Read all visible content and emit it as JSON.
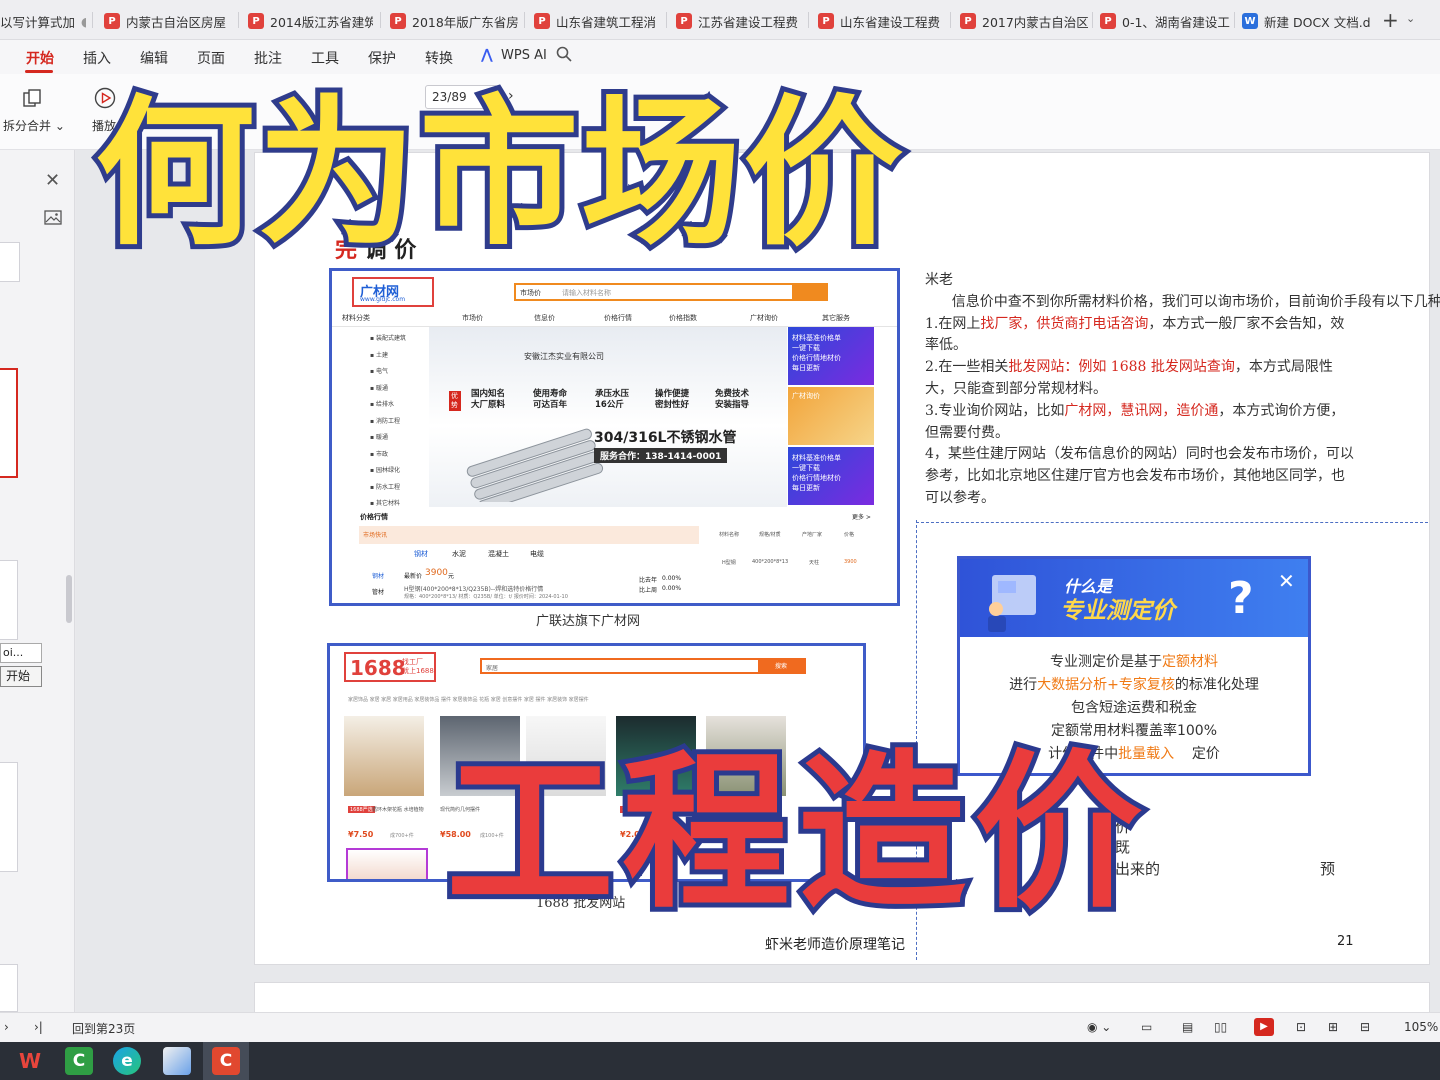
{
  "tabs": [
    {
      "label": "以写计算式加",
      "icon": "none",
      "dot": "●"
    },
    {
      "label": "内蒙古自治区房屋",
      "icon": "pdf-icon"
    },
    {
      "label": "2014版江苏省建筑",
      "icon": "pdf-icon"
    },
    {
      "label": "2018年版广东省房",
      "icon": "pdf-icon"
    },
    {
      "label": "山东省建筑工程消",
      "icon": "pdf-icon"
    },
    {
      "label": "江苏省建设工程费",
      "icon": "pdf-icon"
    },
    {
      "label": "山东省建设工程费",
      "icon": "pdf-icon"
    },
    {
      "label": "2017内蒙古自治区",
      "icon": "pdf-icon"
    },
    {
      "label": "0-1、湖南省建设工",
      "icon": "pdf-icon"
    },
    {
      "label": "新建 DOCX 文档.d",
      "icon": "word-icon",
      "dot": "●"
    }
  ],
  "menu": {
    "start": "开始",
    "insert": "插入",
    "edit": "编辑",
    "page": "页面",
    "annotate": "批注",
    "tools": "工具",
    "protect": "保护",
    "convert": "转换",
    "wps_ai": "WPS AI"
  },
  "toolbar": {
    "split_merge": "拆分合并",
    "play": "播放",
    "page_indicator": "23/89"
  },
  "sidebar": {
    "tooltip": "oi...",
    "context_start": "开始"
  },
  "overlay": {
    "title": "何为市场价",
    "subtitle": "工程造价"
  },
  "doc": {
    "heading_char": "完",
    "heading_rest": "      调      价",
    "caption1": "广联达旗下广材网",
    "caption2": "1688 批发网站",
    "footer_title": "虾米老师造价原理笔记",
    "page_number": "21",
    "right": {
      "p1a": "米老",
      "p1b": "      信息价中查不到你所需材料价格，我们可以询市场价，目前询价手段有以下几种。",
      "p2a": "1.在网上",
      "p2b": "找厂家，供货商打电话咨询",
      "p2c": "，本方式一般厂家不会告知，效率低。",
      "p3a": "2.在一些相关",
      "p3b": "批发网站：例如 1688 批发网站查询",
      "p3c": "，本方式局限性大，只能查到部分常规材料。",
      "p4a": "3.专业询价网站，比如",
      "p4b": "广材网，慧讯网，造价通",
      "p4c": "，本方式询价方便，但需要付费。",
      "p5": "4，某些住建厅网站（发布信息价的网站）同时也会发布市场价，可以参考，比如北京地区住建厅官方也会发布市场价，其他地区同学，也可以参考。"
    },
    "bottom_lines": [
      "定价",
      "它既",
      "新出来的",
      "预"
    ]
  },
  "popup": {
    "title1": "什么是",
    "title2": "专业测定价",
    "q": "?",
    "close": "✕",
    "line1": "专业测定价是基于",
    "line1_hl": "定额材料",
    "line2a": "进行",
    "line2_hl": "大数据分析+专家复核",
    "line2b": "的标准化处理",
    "line3": "包含短途运费和税金",
    "line4": "定额常用材料覆盖率100%",
    "line5a": "计价软件中",
    "line5_hl": "批量载入",
    "line5b": "    定价"
  },
  "shot1": {
    "logo": "广材网",
    "logo_url": "www.gldjc.com",
    "search_scope": "市场价",
    "search_placeholder": "请输入材料名称",
    "nav": [
      "市场价",
      "信息价",
      "价格行情",
      "价格指数",
      "广材询价",
      "其它服务"
    ],
    "categories_title": "材料分类",
    "categories": [
      "装配式建筑",
      "土建",
      "电气",
      "暖通",
      "给排水",
      "消防工程",
      "暖通",
      "市政",
      "园林绿化",
      "防水工程",
      "其它材料"
    ],
    "company": "安徽江杰实业有限公司",
    "features": [
      "国内知名\n大厂原料",
      "使用寿命\n可达百年",
      "承压水压\n16公斤",
      "操作便捷\n密封性好",
      "免费技术\n安装指导"
    ],
    "tag": "优势",
    "pipe_title": "304/316L不锈钢水管",
    "hotline": "服务合作：138-1414-0001",
    "ad_text": "材料基准价格单\n一键下载\n价格行情地材价\n每日更新",
    "ad2_text": "广材询价",
    "trend_title": "价格行情",
    "more": "更多 >",
    "market_tab": "市场快讯",
    "tabs": [
      "钢材",
      "水泥",
      "混凝土",
      "电缆"
    ],
    "side_tabs": [
      "钢材",
      "管材"
    ],
    "latest_price_label": "最新价",
    "latest_price": "3900",
    "price_unit": "元",
    "product": "H型钢(400*200*8*13/Q235B)--焊和选特价格行情",
    "spec": "规格：400*200*8*13/ 材质：Q235B/ 单位：t/ 报价时间：2024-01-10",
    "yoy_label": "比去年",
    "yoy": "0.00%",
    "mom_label": "比上周",
    "mom": "0.00%",
    "table_headers": [
      "材料名称",
      "规格/材质",
      "产地厂家",
      "价格"
    ],
    "table_row": [
      "H型钢",
      "400*200*8*13",
      "天柱",
      "3900"
    ]
  },
  "shot2": {
    "logo": "1688",
    "slogan": "找工厂\n就上1688",
    "search_value": "家居",
    "search_btn": "搜索",
    "categories": "家居饰品  家居  家居  家居用品  家居装饰品  摆件  家居装饰品  花瓶  家居  创意摆件  家居  摆件  家居装饰  家居摆件",
    "products": [
      {
        "badge": "1688严选",
        "desc": "循环木架花瓶 水培植物",
        "price": "¥7.50",
        "sold": "成700+件"
      },
      {
        "badge": "",
        "desc": "现代简约几何摆件",
        "price": "¥58.00",
        "sold": "成100+件"
      },
      {
        "badge": "",
        "desc": "",
        "price": "",
        "sold": ""
      },
      {
        "badge": "1688严选",
        "desc": "倒流香炉",
        "price": "¥2.00",
        "sold": ""
      },
      {
        "badge": "",
        "desc": "",
        "price": "",
        "sold": ""
      }
    ]
  },
  "status": {
    "back_to_page": "回到第23页",
    "zoom": "105%"
  },
  "colors": {
    "accent": "#d5281f",
    "title_yellow": "#ffe23a",
    "title_red": "#ea3c3c",
    "outline_blue": "#2f3c8c",
    "frame_blue": "#3f5cc8"
  }
}
